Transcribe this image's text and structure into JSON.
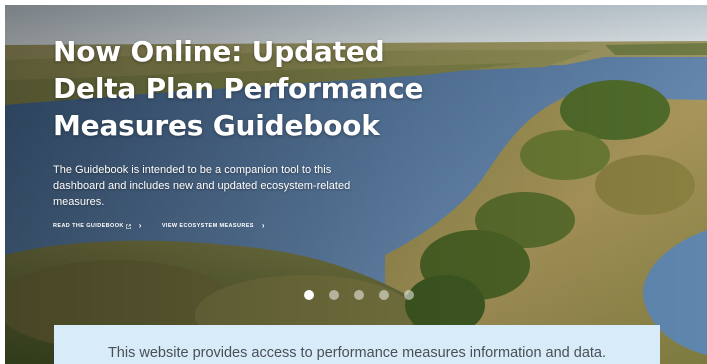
{
  "hero": {
    "title_lines": [
      "Now Online: Updated",
      "Delta Plan Performance",
      "Measures Guidebook"
    ],
    "description": "The Guidebook is intended to be a companion tool to this dashboard and includes new and updated ecosystem-related measures.",
    "links": [
      {
        "label": "READ THE GUIDEBOOK",
        "external_icon": "external-link-icon",
        "arrow_icon": "chevron-right-icon"
      },
      {
        "label": "VIEW ECOSYSTEM MEASURES",
        "arrow_icon": "chevron-right-icon"
      }
    ]
  },
  "carousel": {
    "slide_count": 5,
    "active_index": 0
  },
  "intro": {
    "text": "This website provides access to performance measures information and data."
  },
  "colors": {
    "banner_bg": "#d8ebf8",
    "banner_text": "#4a4f57",
    "hero_text": "#ffffff"
  }
}
